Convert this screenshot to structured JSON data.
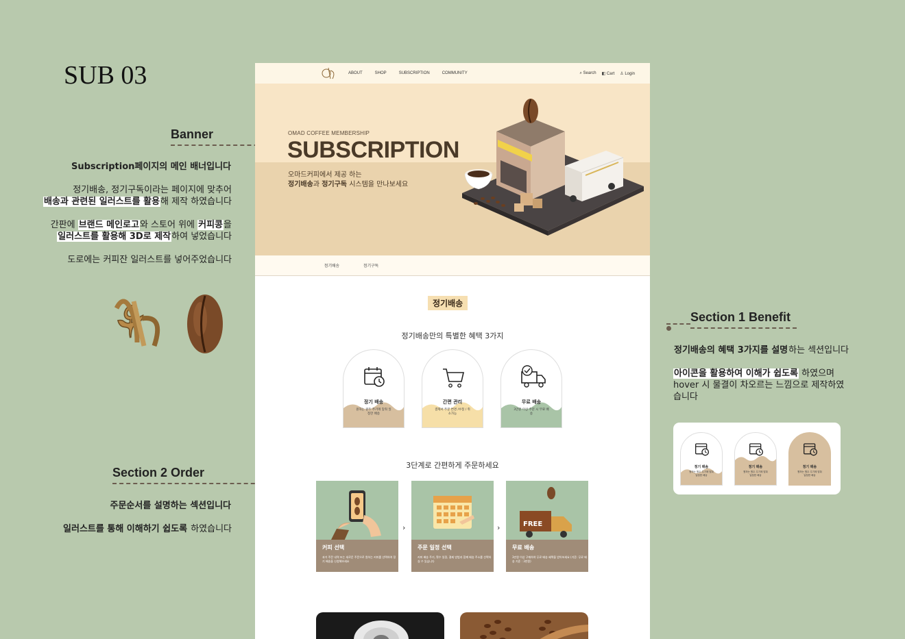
{
  "page_title": "SUB 03",
  "annotations": {
    "banner": {
      "heading": "Banner",
      "lines": [
        {
          "plain_before": "",
          "bold": "Subscription페이지의 메인 배너입니다",
          "plain_after": ""
        },
        {
          "plain_before": "정기배송, 정기구독이라는 페이지에 맞추어",
          "bold": "",
          "plain_after": ""
        },
        {
          "plain_before": "",
          "bold": "배송과 관련된 일러스트를 활용",
          "plain_after": "해 제작 하였습니다"
        },
        {
          "plain_before": "간판에 ",
          "bold": "브랜드 메인로고",
          "plain_after": "와 스토어 위에 "
        },
        {
          "plain_before": "",
          "bold": "커피콩",
          "plain_after": "을"
        },
        {
          "plain_before": "",
          "bold": "일러스트를 활용해 3D로 제작",
          "plain_after": "하여 넣었습니다"
        },
        {
          "plain_before": "도로에는 커피잔 일러스트를 넣어주었습니다",
          "bold": "",
          "plain_after": ""
        }
      ]
    },
    "section2": {
      "heading": "Section 2   Order",
      "line1": "주문순서를 설명하는 섹션입니다",
      "line2_bold": "일러스트를 통해 이해하기 쉽도록",
      "line2_after": " 하였습니다"
    },
    "section1": {
      "heading": "Section 1   Benefit",
      "line1_bold": "정기배송의 혜택 3가지를 설명",
      "line1_after": "하는 섹션입니다",
      "line2_bold": "아이콘을 활용하여 이해가 쉽도록",
      "line2_after": " 하였으며",
      "line3": "hover 시 물결이 차오르는 느낌으로 제작하였",
      "line4": "습니다"
    }
  },
  "site": {
    "nav": {
      "links": [
        "ABOUT",
        "SHOP",
        "SUBSCRIPTION",
        "COMMUNITY"
      ],
      "search": "Search",
      "cart": "Cart",
      "login": "Login"
    },
    "banner": {
      "eyebrow": "OMAD COFFEE MEMBERSHIP",
      "title": "SUBSCRIPTION",
      "desc_line1": "오마드커피에서 제공 하는",
      "desc_b1": "정기배송",
      "desc_mid": "과 ",
      "desc_b2": "정기구독",
      "desc_end": " 시스템을 만나보세요"
    },
    "subtabs": [
      "정기배송",
      "정기구독"
    ],
    "section1": {
      "tag": "정기배송",
      "subtitle": "정기배송만의 특별한 혜택 3가지",
      "cards": [
        {
          "title": "정기 배송",
          "desc": "원하는 원두 주기에 맞춰 일정한 배송",
          "icon": "calendar-clock-icon"
        },
        {
          "title": "간편 관리",
          "desc": "결제서 주문 변경 /수정 / 취소가능",
          "icon": "cart-icon"
        },
        {
          "title": "무료 배송",
          "desc": "3만원 이상 주문 시 무료 배송",
          "icon": "delivery-truck-icon"
        }
      ]
    },
    "section2": {
      "subtitle": "3단계로 간편하게 주문하세요",
      "steps": [
        {
          "title": "커피 선택",
          "desc": "과거 주문 내역 또는 새로운 주문으로 원하는 커피를 선택하여 정기 배송을 신청해보세요"
        },
        {
          "title": "주문 일정 선택",
          "desc": "커피 배송 주기, 횟수 일정, 결제 방법과 함께 배송 주소를 선택하실 수 있습니다"
        },
        {
          "title": "무료 배송",
          "desc": "3만원 이상 구매하여 무료 배송 혜택을 받아보세요 (기준: 무료 배송 기준 : 3만원)"
        }
      ],
      "free_label": "FREE"
    },
    "preview_cards": [
      {
        "title": "정기 배송",
        "desc": "원하는 원두 주기에 맞춰 일정한 배송"
      },
      {
        "title": "정기 배송",
        "desc": "원하는 원두 주기에 맞춰 일정한 배송"
      },
      {
        "title": "정기 배송",
        "desc": "원하는 원두 주기에 맞춰 일정한 배송"
      }
    ]
  },
  "colors": {
    "bg": "#b8c9ad",
    "cream": "#f8e5c6",
    "brown": "#4a3a28",
    "sage": "#a9c4a7",
    "tan": "#d7bf9f"
  }
}
